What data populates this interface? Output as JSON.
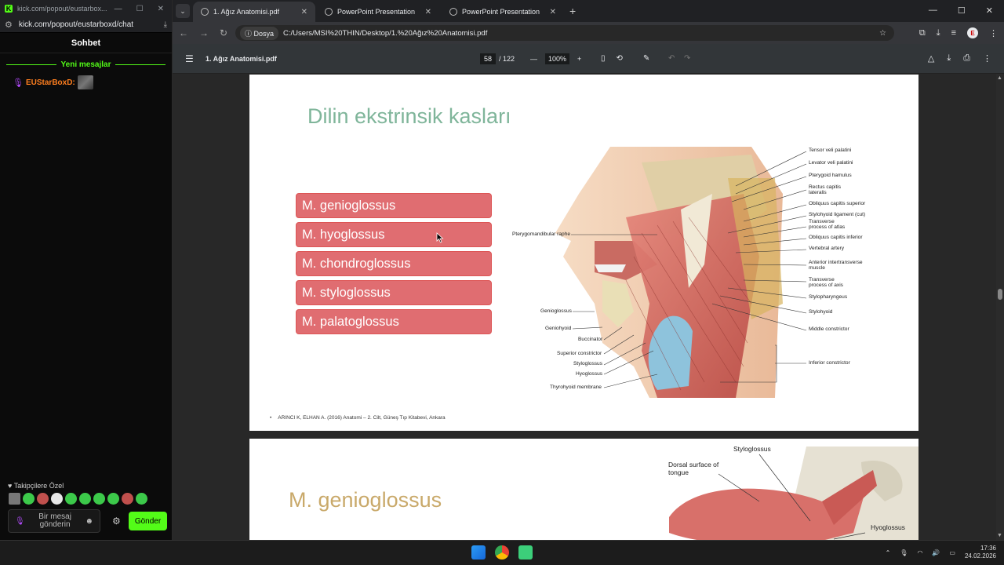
{
  "kick": {
    "window_url_short": "kick.com/popout/eustarbox...",
    "url": "kick.com/popout/eustarboxd/chat",
    "chat_title": "Sohbet",
    "new_messages": "Yeni mesajlar",
    "messages": [
      {
        "user": "EUStarBoxD:"
      }
    ],
    "subs_label": "Takipçilere Özel",
    "input_placeholder_line1": "Bir mesaj",
    "input_placeholder_line2": "gönderin",
    "send_label": "Gönder"
  },
  "chrome": {
    "tabs": [
      {
        "title": "1. Ağız Anatomisi.pdf",
        "active": true
      },
      {
        "title": "PowerPoint Presentation",
        "active": false
      },
      {
        "title": "PowerPoint Presentation",
        "active": false
      }
    ],
    "address_chip": "Dosya",
    "address_url": "C:/Users/MSI%20THIN/Desktop/1.%20Ağız%20Anatomisi.pdf",
    "profile_initial": "E"
  },
  "pdf_toolbar": {
    "file_name": "1. Ağız Anatomisi.pdf",
    "current_page": "58",
    "total_pages": "/ 122",
    "zoom": "100%"
  },
  "slide1": {
    "title": "Dilin ekstrinsik kasları",
    "muscles": [
      "M. genioglossus",
      "M. hyoglossus",
      "M. chondroglossus",
      "M. styloglossus",
      "M. palatoglossus"
    ],
    "reference": "ARINCI K, ELHAN A. (2016) Anatomi – 2. Cilt, Güneş Tıp Kitabevi, Ankara",
    "figure_labels_right": [
      "Tensor veli palatini",
      "Levator veli palatini",
      "Pterygoid hamulus",
      "Rectus capitis lateralis",
      "Obliquus capitis superior",
      "Stylohyoid ligament (cut)",
      "Transverse process of atlas",
      "Obliquus capitis inferior",
      "Vertebral artery",
      "Anterior intertransverse muscle",
      "Transverse process of axis",
      "Stylopharyngeus",
      "Stylohyoid",
      "Middle constrictor",
      "Inferior constrictor"
    ],
    "figure_labels_left": [
      "Pterygomandibular raphe",
      "Genioglossus",
      "Geniohyoid",
      "Buccinator",
      "Superior constrictor",
      "Styloglossus",
      "Hyoglossus",
      "Thyrohyoid membrane"
    ]
  },
  "slide2": {
    "title": "M. genioglossus",
    "figure_labels": [
      "Styloglossus",
      "Dorsal surface of tongue",
      "Hyoglossus"
    ]
  },
  "taskbar": {
    "time": "17:36",
    "date": "24.02.2026"
  }
}
